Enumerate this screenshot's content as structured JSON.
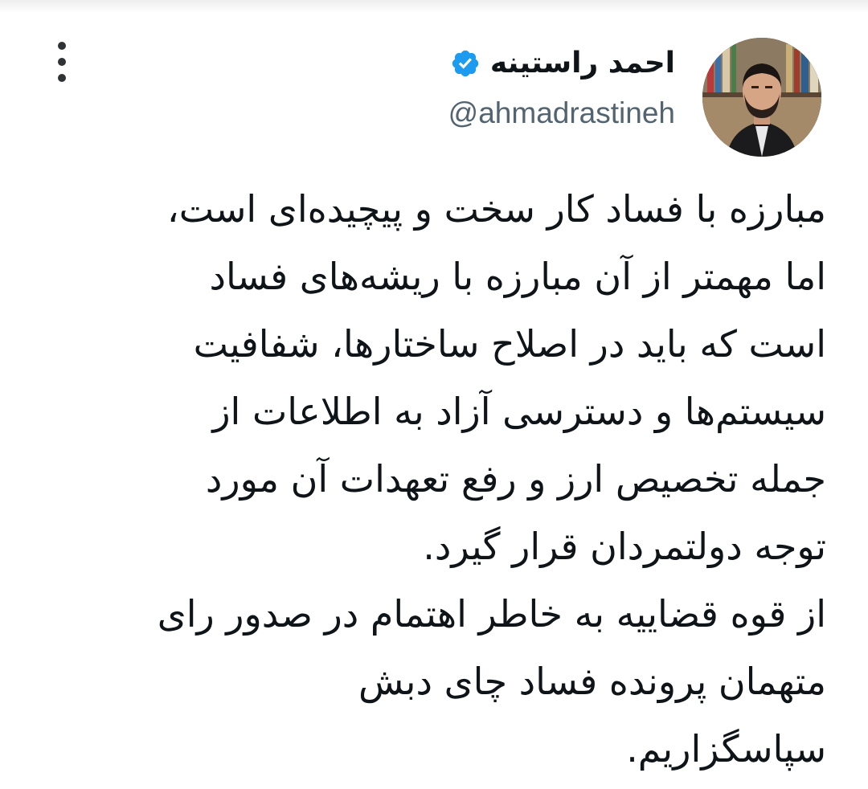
{
  "tweet": {
    "author": {
      "display_name": "احمد راستینه",
      "handle": "@ahmadrastineh",
      "verified": true,
      "verified_color": "#1d9bf0"
    },
    "icons": {
      "more": "more-vertical-icon",
      "verified": "verified-badge-icon",
      "avatar": "profile-photo"
    },
    "text": "مبارزه با فساد کار سخت و پیچیده‌ای است،\nاما مهمتر از آن مبارزه با ریشه‌های فساد\nاست که باید در اصلاح ساختارها، شفافیت\nسیستم‌ها و دسترسی آزاد به اطلاعات از\nجمله تخصیص ارز و رفع تعهدات آن مورد\nتوجه دولتمردان قرار گیرد.\nاز قوه قضاییه به خاطر اهتمام در صدور رای\nمتهمان پرونده فساد چای دبش\nسپاسگزاریم."
  }
}
